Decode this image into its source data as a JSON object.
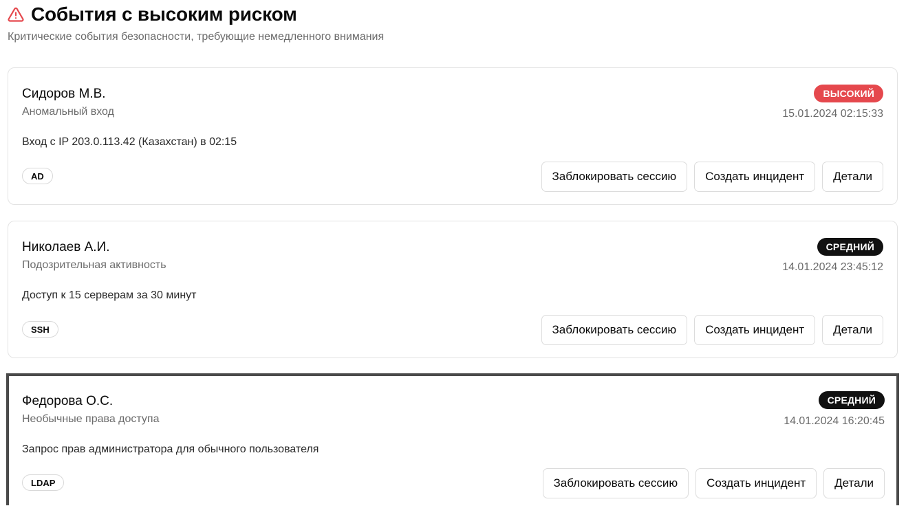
{
  "header": {
    "icon": "warning-triangle-icon",
    "icon_color": "#e5484d",
    "title": "События с высоким риском",
    "subtitle": "Критические события безопасности, требующие немедленного внимания"
  },
  "colors": {
    "high": "#e5484d",
    "medium": "#111111"
  },
  "events": [
    {
      "user": "Сидоров М.В.",
      "type": "Аномальный вход",
      "risk": "ВЫСОКИЙ",
      "risk_level": "high",
      "timestamp": "15.01.2024 02:15:33",
      "description": "Вход с IP 203.0.113.42 (Казахстан) в 02:15",
      "source": "AD",
      "selected": false
    },
    {
      "user": "Николаев А.И.",
      "type": "Подозрительная активность",
      "risk": "СРЕДНИЙ",
      "risk_level": "medium",
      "timestamp": "14.01.2024 23:45:12",
      "description": "Доступ к 15 серверам за 30 минут",
      "source": "SSH",
      "selected": false
    },
    {
      "user": "Федорова О.С.",
      "type": "Необычные права доступа",
      "risk": "СРЕДНИЙ",
      "risk_level": "medium",
      "timestamp": "14.01.2024 16:20:45",
      "description": "Запрос прав администратора для обычного пользователя",
      "source": "LDAP",
      "selected": true
    }
  ],
  "actions": {
    "block": "Заблокировать сессию",
    "incident": "Создать инцидент",
    "details": "Детали"
  }
}
